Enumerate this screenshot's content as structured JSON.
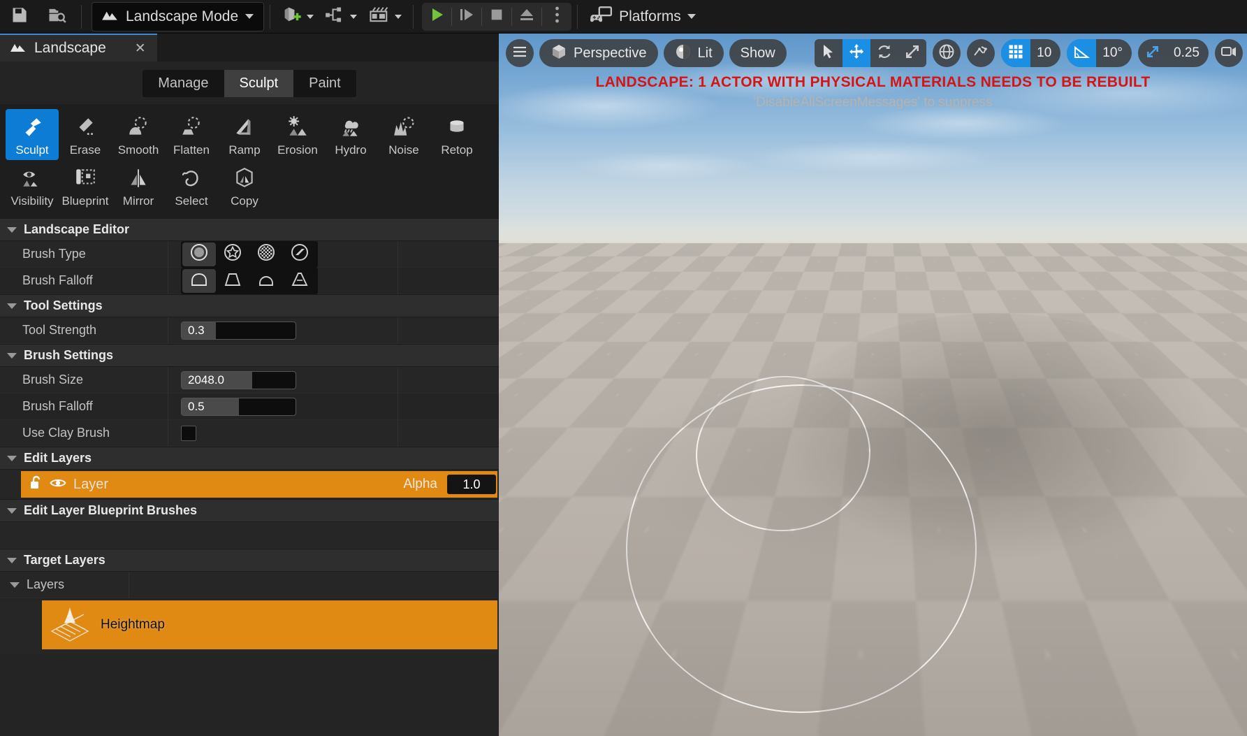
{
  "toolbar": {
    "save_icon": "save-icon",
    "browse_icon": "browse-content-icon",
    "mode_label": "Landscape Mode",
    "mode_icon": "landscape-mode-icon",
    "add_icon": "add-actor-icon",
    "blueprint_icon": "blueprints-icon",
    "cinematics_icon": "cinematics-icon",
    "play_icon": "play-icon",
    "skip_icon": "skip-play-icon",
    "stop_icon": "stop-icon",
    "eject_icon": "eject-icon",
    "more_icon": "more-options-icon",
    "platforms_label": "Platforms",
    "platforms_icon": "platforms-icon"
  },
  "panel": {
    "tab_title": "Landscape",
    "tab_icon": "landscape-icon",
    "close_icon": "close-icon",
    "mode_tabs": [
      {
        "label": "Manage",
        "active": false
      },
      {
        "label": "Sculpt",
        "active": true
      },
      {
        "label": "Paint",
        "active": false
      }
    ],
    "tools_row1": [
      {
        "label": "Sculpt",
        "icon": "trowel-icon",
        "active": true
      },
      {
        "label": "Erase",
        "icon": "eraser-icon",
        "active": false
      },
      {
        "label": "Smooth",
        "icon": "smooth-icon",
        "active": false
      },
      {
        "label": "Flatten",
        "icon": "flatten-icon",
        "active": false
      },
      {
        "label": "Ramp",
        "icon": "ramp-icon",
        "active": false
      },
      {
        "label": "Erosion",
        "icon": "erosion-sun-icon",
        "active": false
      },
      {
        "label": "Hydro",
        "icon": "hydro-rain-icon",
        "active": false
      },
      {
        "label": "Noise",
        "icon": "noise-icon",
        "active": false
      },
      {
        "label": "Retop",
        "icon": "retopologize-icon",
        "active": false
      }
    ],
    "tools_row2": [
      {
        "label": "Visibility",
        "icon": "visibility-eye-icon",
        "active": false
      },
      {
        "label": "Blueprint",
        "icon": "blueprint-brush-icon",
        "active": false
      },
      {
        "label": "Mirror",
        "icon": "mirror-icon",
        "active": false
      },
      {
        "label": "Select",
        "icon": "select-lasso-icon",
        "active": false
      },
      {
        "label": "Copy",
        "icon": "copy-paste-icon",
        "active": false
      }
    ],
    "sections": {
      "landscape_editor": "Landscape Editor",
      "tool_settings": "Tool Settings",
      "brush_settings": "Brush Settings",
      "edit_layers": "Edit Layers",
      "edit_layer_blueprint_brushes": "Edit Layer Blueprint Brushes",
      "target_layers": "Target Layers"
    },
    "brush_type": {
      "label": "Brush Type",
      "options": [
        {
          "icon": "circle-brush-icon",
          "active": true
        },
        {
          "icon": "alpha-brush-icon",
          "active": false
        },
        {
          "icon": "pattern-brush-icon",
          "active": false
        },
        {
          "icon": "component-brush-icon",
          "active": false
        }
      ]
    },
    "brush_falloff_type": {
      "label": "Brush Falloff",
      "options": [
        {
          "icon": "smooth-falloff-icon",
          "active": true
        },
        {
          "icon": "linear-falloff-icon",
          "active": false
        },
        {
          "icon": "spherical-falloff-icon",
          "active": false
        },
        {
          "icon": "tip-falloff-icon",
          "active": false
        }
      ]
    },
    "tool_strength": {
      "label": "Tool Strength",
      "value": "0.3",
      "fill_pct": 30
    },
    "brush_size": {
      "label": "Brush Size",
      "value": "2048.0",
      "fill_pct": 62
    },
    "brush_falloff": {
      "label": "Brush Falloff",
      "value": "0.5",
      "fill_pct": 50
    },
    "use_clay_brush": {
      "label": "Use Clay Brush",
      "checked": false
    },
    "edit_layer": {
      "lock_icon": "unlocked-icon",
      "visible_icon": "eye-icon",
      "name": "Layer",
      "alpha_label": "Alpha",
      "alpha_value": "1.0"
    },
    "layers_group_label": "Layers",
    "target_layer": {
      "name": "Heightmap",
      "icon": "heightmap-icon"
    }
  },
  "viewport": {
    "menu_icon": "hamburger-menu-icon",
    "camera_label": "Perspective",
    "camera_icon": "cube-icon",
    "viewmode_label": "Lit",
    "viewmode_icon": "lit-sphere-icon",
    "show_label": "Show",
    "transform_tools": [
      {
        "icon": "select-arrow-icon",
        "active": false
      },
      {
        "icon": "move-gizmo-icon",
        "active": true
      },
      {
        "icon": "rotate-gizmo-icon",
        "active": false
      },
      {
        "icon": "scale-gizmo-icon",
        "active": false
      }
    ],
    "coord_icon": "world-globe-icon",
    "surface_snap_icon": "surface-snap-icon",
    "grid_snap": {
      "icon": "grid-snap-icon",
      "value": "10",
      "active": true
    },
    "angle_snap": {
      "icon": "angle-snap-icon",
      "value": "10°",
      "active": true
    },
    "scale_snap": {
      "icon": "scale-snap-icon",
      "value": "0.25",
      "active": false
    },
    "camera_speed_icon": "camera-speed-icon",
    "warning_line1": "LANDSCAPE: 1 ACTOR WITH PHYSICAL MATERIALS NEEDS TO BE REBUILT",
    "warning_line2": "'DisableAllScreenMessages' to suppress"
  }
}
